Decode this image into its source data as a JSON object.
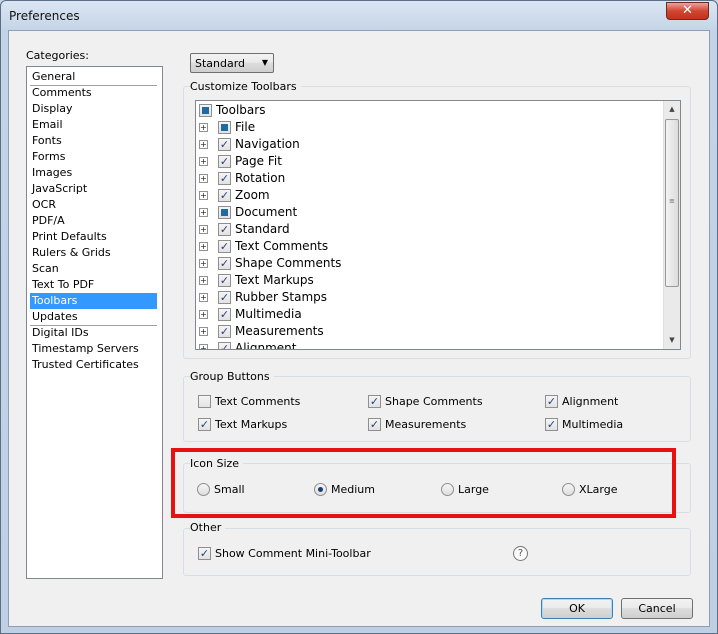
{
  "window": {
    "title": "Preferences",
    "close_glyph": "✕"
  },
  "categories": {
    "label": "Categories:",
    "items": [
      "General",
      "Comments",
      "Display",
      "Email",
      "Fonts",
      "Forms",
      "Images",
      "JavaScript",
      "OCR",
      "PDF/A",
      "Print Defaults",
      "Rulers & Grids",
      "Scan",
      "Text To PDF",
      "Toolbars",
      "Updates",
      "Digital IDs",
      "Timestamp Servers",
      "Trusted Certificates"
    ],
    "selected": "Toolbars"
  },
  "preset": {
    "selected": "Standard"
  },
  "customize": {
    "title": "Customize Toolbars",
    "root": {
      "label": "Toolbars",
      "state": "partial"
    },
    "items": [
      {
        "label": "File",
        "state": "partial"
      },
      {
        "label": "Navigation",
        "state": "checked"
      },
      {
        "label": "Page Fit",
        "state": "checked"
      },
      {
        "label": "Rotation",
        "state": "checked"
      },
      {
        "label": "Zoom",
        "state": "checked"
      },
      {
        "label": "Document",
        "state": "partial"
      },
      {
        "label": "Standard",
        "state": "checked"
      },
      {
        "label": "Text Comments",
        "state": "checked"
      },
      {
        "label": "Shape Comments",
        "state": "checked"
      },
      {
        "label": "Text Markups",
        "state": "checked"
      },
      {
        "label": "Rubber Stamps",
        "state": "checked"
      },
      {
        "label": "Multimedia",
        "state": "checked"
      },
      {
        "label": "Measurements",
        "state": "checked"
      },
      {
        "label": "Alignment",
        "state": "checked"
      }
    ]
  },
  "group_buttons": {
    "title": "Group Buttons",
    "options": [
      {
        "label": "Text Comments",
        "checked": false
      },
      {
        "label": "Shape Comments",
        "checked": true
      },
      {
        "label": "Alignment",
        "checked": true
      },
      {
        "label": "Text Markups",
        "checked": true
      },
      {
        "label": "Measurements",
        "checked": true
      },
      {
        "label": "Multimedia",
        "checked": true
      }
    ]
  },
  "icon_size": {
    "title": "Icon Size",
    "options": [
      "Small",
      "Medium",
      "Large",
      "XLarge"
    ],
    "selected": "Medium"
  },
  "other": {
    "title": "Other",
    "show_mini_toolbar": {
      "label": "Show Comment Mini-Toolbar",
      "checked": true
    },
    "help_glyph": "?"
  },
  "buttons": {
    "ok": "OK",
    "cancel": "Cancel"
  },
  "glyphs": {
    "check": "✓",
    "expand": "+",
    "dropdown_arrow": "▼",
    "scroll_up": "▲",
    "scroll_down": "▼",
    "grip": "≡"
  },
  "colors": {
    "selection": "#3399ff",
    "highlight_box": "#e81010"
  }
}
